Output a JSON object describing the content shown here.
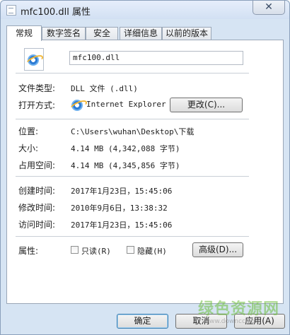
{
  "window": {
    "title": "mfc100.dll 属性",
    "close_glyph": "✕"
  },
  "tabs": [
    {
      "label": "常规",
      "active": true
    },
    {
      "label": "数字签名",
      "active": false
    },
    {
      "label": "安全",
      "active": false
    },
    {
      "label": "详细信息",
      "active": false
    },
    {
      "label": "以前的版本",
      "active": false
    }
  ],
  "general": {
    "file_name": "mfc100.dll",
    "file_type_label": "文件类型:",
    "file_type_value": "DLL 文件 (.dll)",
    "opens_with_label": "打开方式:",
    "opens_with_value": "Internet Explorer",
    "change_button": "更改(C)...",
    "location_label": "位置:",
    "location_value": "C:\\Users\\wuhan\\Desktop\\下载",
    "size_label": "大小:",
    "size_value": "4.14 MB (4,342,088 字节)",
    "size_on_disk_label": "占用空间:",
    "size_on_disk_value": "4.14 MB (4,345,856 字节)",
    "created_label": "创建时间:",
    "created_value": "2017年1月23日，15:45:06",
    "modified_label": "修改时间:",
    "modified_value": "2010年9月6日，13:38:32",
    "accessed_label": "访问时间:",
    "accessed_value": "2017年1月23日，15:45:06",
    "attributes_label": "属性:",
    "readonly_label": "只读(R)",
    "hidden_label": "隐藏(H)",
    "advanced_button": "高级(D)..."
  },
  "footer": {
    "ok_button": "确定",
    "cancel_button": "取消",
    "apply_button": "应用(A)"
  },
  "watermark": {
    "text": "绿色资源网",
    "url": "www.downcc.com"
  },
  "icons": {
    "file": "ie-file-icon",
    "opens_with": "ie-icon"
  }
}
